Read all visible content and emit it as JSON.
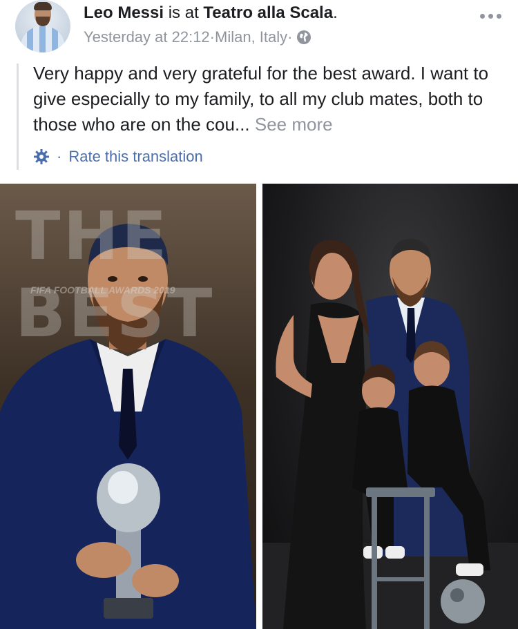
{
  "post": {
    "author": "Leo Messi",
    "connector": " is at ",
    "place": "Teatro alla Scala",
    "place_suffix": ".",
    "timestamp": "Yesterday at 22:12",
    "meta_sep_1": " · ",
    "location": "Milan, Italy",
    "meta_sep_2": " · ",
    "privacy_icon": "globe-icon",
    "text": "Very happy and very grateful for the best award. I want to give especially to my family, to all my club mates, both to those who are on the cou...",
    "see_more": " See more",
    "translation_sep": "·",
    "rate_translation": "Rate this translation",
    "menu_icon": "more-options-icon",
    "settings_icon": "gear-icon"
  },
  "photos": {
    "left_bg_text": "THE BEST",
    "left_bg_small": "FIFA FOOTBALL AWARDS 2019"
  },
  "colors": {
    "text": "#1c1e21",
    "meta": "#90949c",
    "link": "#4b6eaa",
    "divider": "#dddfe2"
  }
}
